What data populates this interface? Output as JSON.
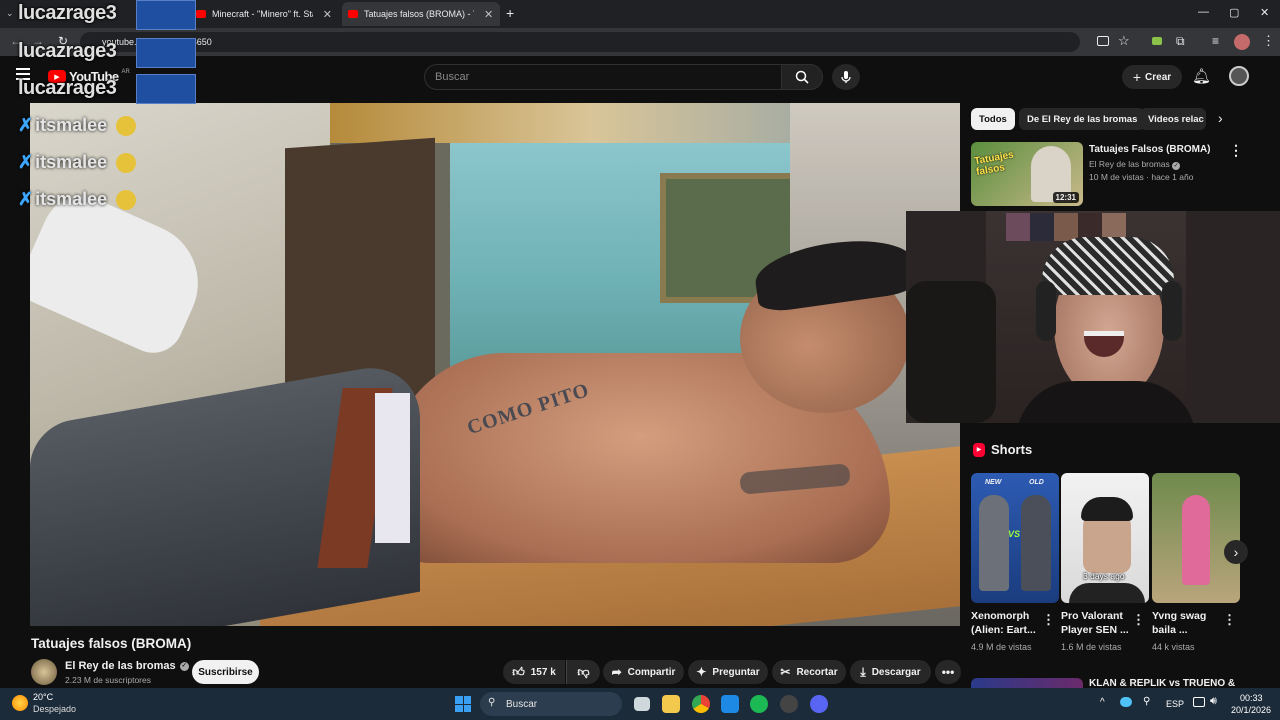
{
  "browser": {
    "tabs": [
      {
        "label": "Minecraft - \"Minero\" ft. Starkin..."
      },
      {
        "label": "Tatuajes falsos (BROMA) - YouT..."
      }
    ],
    "url": "youtube.com/watch?v=DwED0ZFS650",
    "url_visible": "youtube... =DwED0ZFS650"
  },
  "youtube": {
    "logo": "YouTube",
    "country": "AR",
    "search_placeholder": "Buscar",
    "create_label": "Crear"
  },
  "overlay": {
    "streamer_name": "lucazrage3",
    "chat": [
      {
        "user": "itsmalee"
      },
      {
        "user": "itsmalee"
      },
      {
        "user": "itsmalee"
      }
    ]
  },
  "video": {
    "title": "Tatuajes falsos (BROMA)",
    "tattoo_text": "COMO PITO",
    "channel": "El Rey de las bromas",
    "subscribers": "2.23 M de suscriptores",
    "subscribe_label": "Suscribirse",
    "likes": "157 k",
    "share_label": "Compartir",
    "ask_label": "Preguntar",
    "clip_label": "Recortar",
    "download_label": "Descargar"
  },
  "sidebar": {
    "chips": [
      {
        "label": "Todos",
        "active": true
      },
      {
        "label": "De El Rey de las bromas",
        "active": false
      },
      {
        "label": "Videos relac",
        "active": false
      }
    ],
    "recommended": [
      {
        "title": "Tatuajes Falsos (BROMA)",
        "channel": "El Rey de las bromas",
        "meta": "10 M de vistas · hace 1 año",
        "duration": "12:31",
        "thumb_text": "Tatuajes falsos"
      },
      {
        "title": "KLAN & REPLIK vs TRUENO &"
      }
    ],
    "shorts_title": "Shorts",
    "shorts": [
      {
        "title": "Xenomorph (Alien: Eart...",
        "views": "4.9 M de vistas",
        "badge_new": "NEW",
        "badge_old": "OLD",
        "vs": "VS"
      },
      {
        "title": "Pro Valorant Player SEN ...",
        "views": "1.6 M de vistas",
        "badge": "3 days ago"
      },
      {
        "title": "Yvng swag baila ...",
        "views": "44 k vistas"
      }
    ]
  },
  "taskbar": {
    "weather_temp": "20°C",
    "weather_desc": "Despejado",
    "search_label": "Buscar",
    "lang": "ESP",
    "time": "00:33",
    "date": "20/1/2026"
  }
}
